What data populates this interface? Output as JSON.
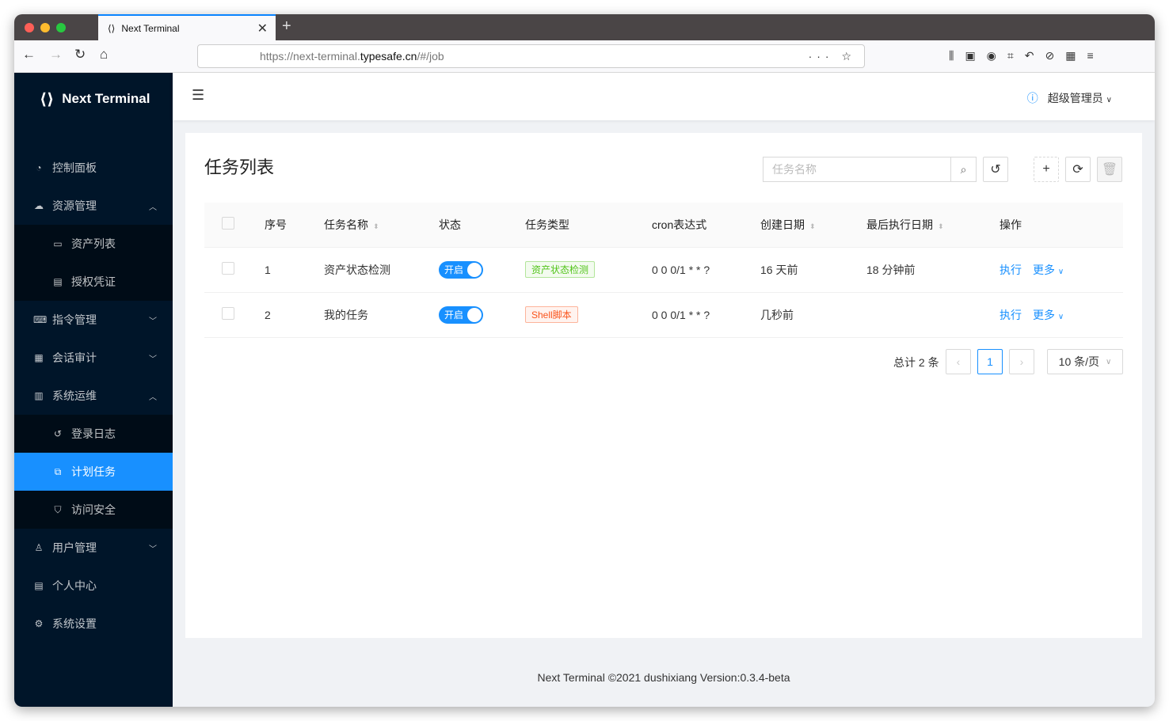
{
  "browser": {
    "tab_title": "Next Terminal",
    "url_prefix": "https://next-terminal.",
    "url_domain": "typesafe.cn",
    "url_suffix": "/#/job"
  },
  "sidebar": {
    "brand": "Next Terminal",
    "items": [
      {
        "label": "控制面板",
        "icon": "dashboard-icon"
      },
      {
        "label": "资源管理",
        "icon": "cloud-icon",
        "arrow": "^"
      },
      {
        "label": "资产列表",
        "icon": "desktop-icon",
        "sub": true
      },
      {
        "label": "授权凭证",
        "icon": "idcard-icon",
        "sub": true
      },
      {
        "label": "指令管理",
        "icon": "code-icon",
        "arrow": "v"
      },
      {
        "label": "会话审计",
        "icon": "audit-icon",
        "arrow": "v"
      },
      {
        "label": "系统运维",
        "icon": "ops-icon",
        "arrow": "^"
      },
      {
        "label": "登录日志",
        "icon": "history-icon",
        "sub": true
      },
      {
        "label": "计划任务",
        "icon": "copy-icon",
        "sub": true,
        "active": true
      },
      {
        "label": "访问安全",
        "icon": "shield-icon",
        "sub": true
      },
      {
        "label": "用户管理",
        "icon": "user-icon",
        "arrow": "v"
      },
      {
        "label": "个人中心",
        "icon": "profile-icon"
      },
      {
        "label": "系统设置",
        "icon": "gear-icon"
      }
    ]
  },
  "header": {
    "user": "超级管理员"
  },
  "page": {
    "title": "任务列表",
    "search_placeholder": "任务名称"
  },
  "table": {
    "columns": [
      "序号",
      "任务名称",
      "状态",
      "任务类型",
      "cron表达式",
      "创建日期",
      "最后执行日期",
      "操作"
    ],
    "rows": [
      {
        "no": "1",
        "name": "资产状态检测",
        "status": "开启",
        "type": "资产状态检测",
        "type_color": "#52c41a",
        "cron": "0 0 0/1 * * ?",
        "created": "16 天前",
        "last": "18 分钟前",
        "exec": "执行",
        "more": "更多"
      },
      {
        "no": "2",
        "name": "我的任务",
        "status": "开启",
        "type": "Shell脚本",
        "type_color": "#fa541c",
        "cron": "0 0 0/1 * * ?",
        "created": "几秒前",
        "last": "",
        "exec": "执行",
        "more": "更多"
      }
    ]
  },
  "pagination": {
    "total": "总计 2 条",
    "current": "1",
    "page_size": "10 条/页"
  },
  "footer": "Next Terminal ©2021 dushixiang Version:0.3.4-beta"
}
